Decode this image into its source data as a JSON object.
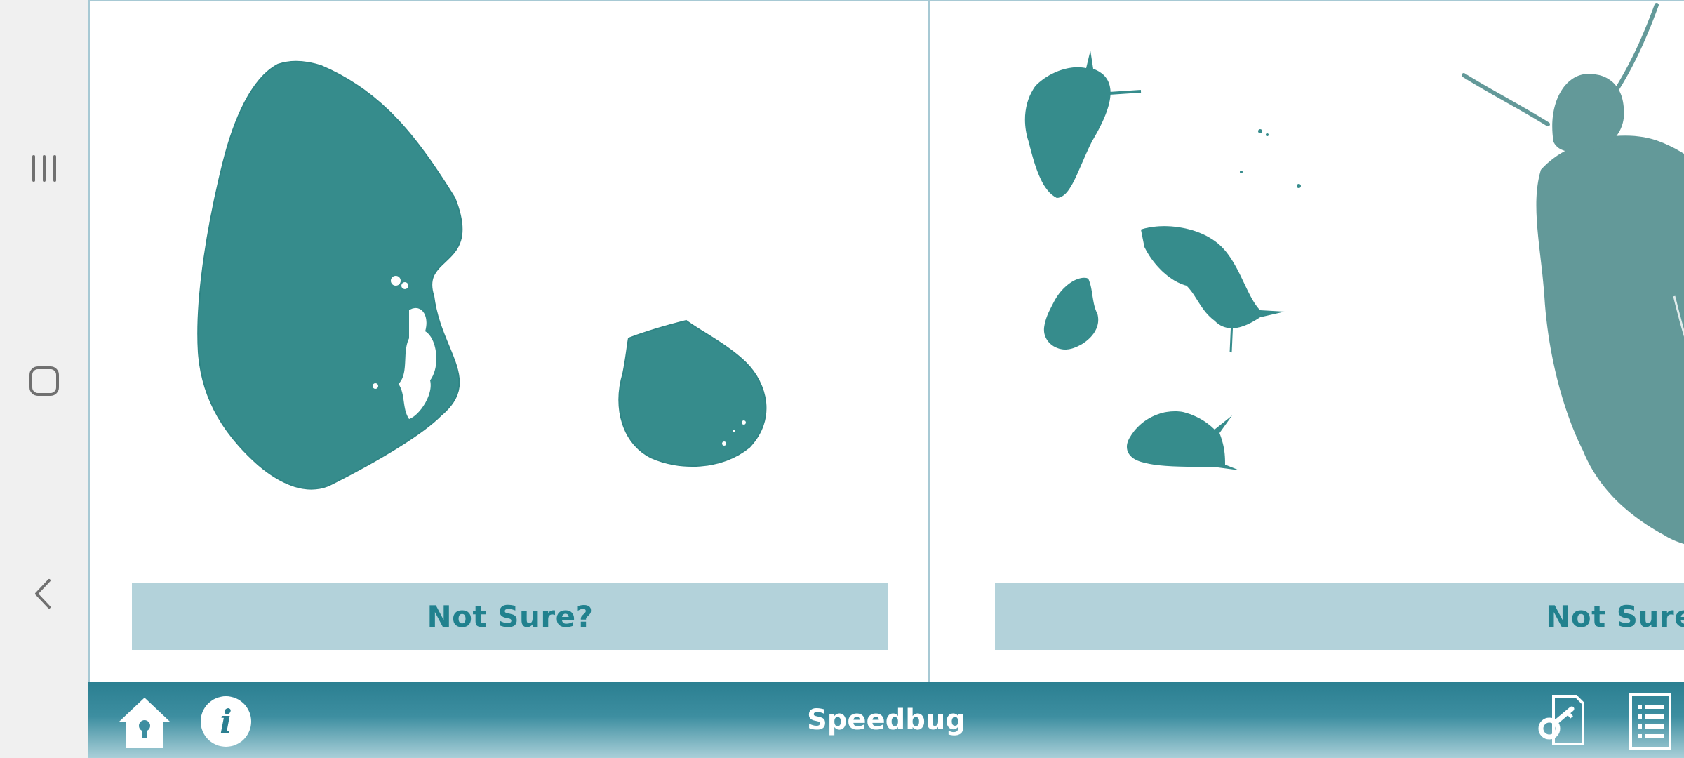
{
  "app": {
    "title": "Speedbug"
  },
  "panels": {
    "left": {
      "not_sure_label": "Not Sure?"
    },
    "right": {
      "not_sure_label": "Not Sure?"
    }
  },
  "footer": {
    "icons": [
      "home-icon",
      "info-icon",
      "key-document-icon",
      "list-icon"
    ]
  },
  "system_nav": {
    "icons": [
      "recent-apps-icon",
      "home-icon",
      "back-icon"
    ]
  },
  "colors": {
    "accent": "#368c8c",
    "specimen_grey": "#639999",
    "button_bg": "#b3d2da",
    "button_text": "#21818e",
    "footer_top": "#2b7f91",
    "footer_bottom": "#a9cfd8"
  }
}
